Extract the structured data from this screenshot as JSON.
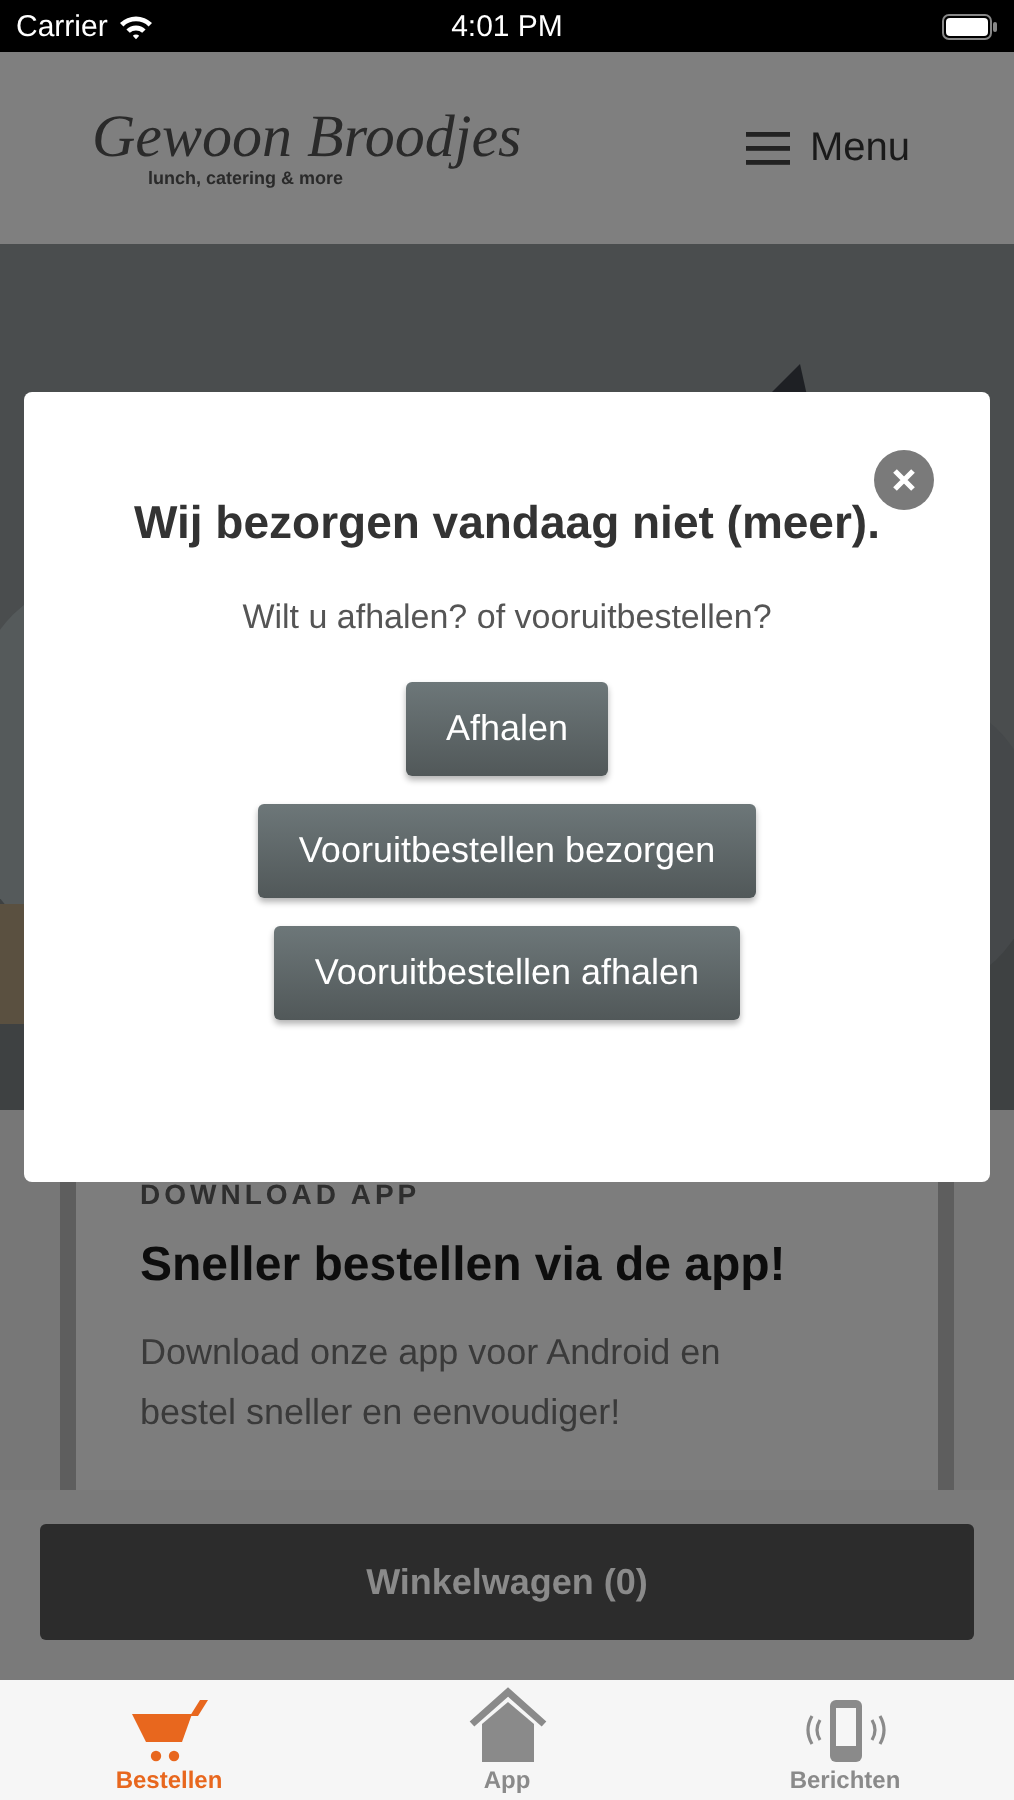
{
  "status_bar": {
    "carrier": "Carrier",
    "time": "4:01 PM"
  },
  "header": {
    "logo": "Gewoon Broodjes",
    "tagline": "lunch, catering & more",
    "menu_label": "Menu"
  },
  "card": {
    "eyebrow": "DOWNLOAD APP",
    "title": "Sneller bestellen via de app!",
    "text": "Download onze app voor Android en bestel sneller en eenvoudiger!"
  },
  "cart_button": "Winkelwagen (0)",
  "modal": {
    "title": "Wij bezorgen vandaag niet (meer).",
    "question": "Wilt u afhalen? of vooruitbestellen?",
    "buttons": [
      "Afhalen",
      "Vooruitbestellen bezorgen",
      "Vooruitbestellen afhalen"
    ]
  },
  "tabs": [
    {
      "label": "Bestellen",
      "kind": "cart",
      "selected": true
    },
    {
      "label": "App",
      "kind": "home",
      "selected": false
    },
    {
      "label": "Berichten",
      "kind": "phone",
      "selected": false
    }
  ]
}
